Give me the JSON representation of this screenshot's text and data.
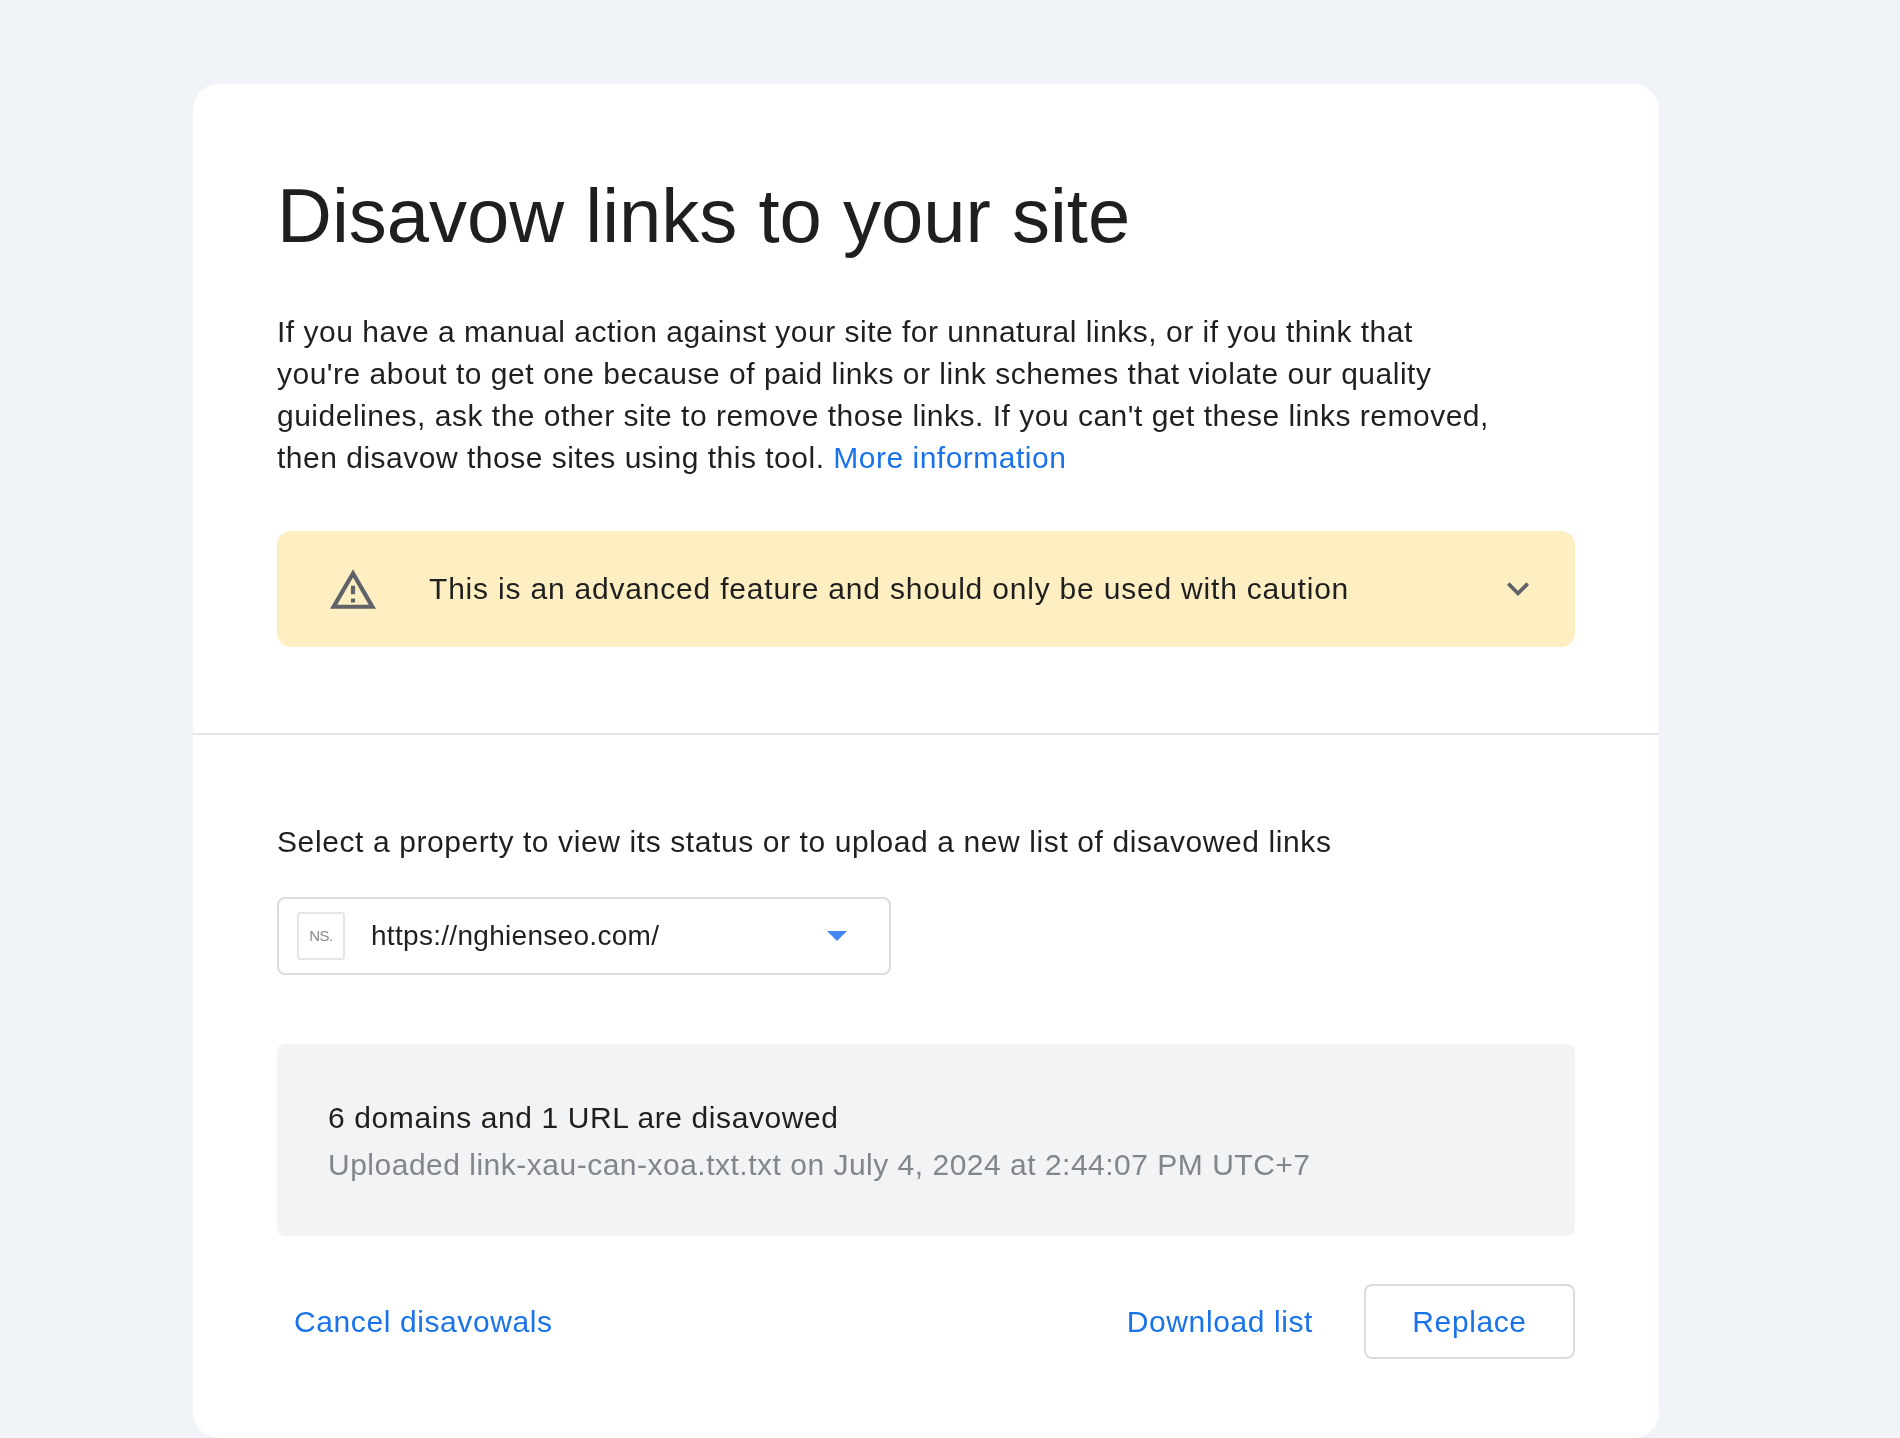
{
  "title": "Disavow links to your site",
  "intro": {
    "text": "If you have a manual action against your site for unnatural links, or if you think that you're about to get one because of paid links or link schemes that violate our quality guidelines, ask the other site to remove those links. If you can't get these links removed, then disavow those sites using this tool.",
    "link": "More information"
  },
  "warning": {
    "text": "This is an advanced feature and should only be used with caution",
    "expanded": false
  },
  "property_picker": {
    "label": "Select a property to view its status or to upload a new list of disavowed links",
    "favicon_text": "NS.",
    "value": "https://nghienseo.com/"
  },
  "status": {
    "summary": "6 domains and 1 URL are disavowed",
    "detail": "Uploaded link-xau-can-xoa.txt.txt on July 4, 2024 at 2:44:07 PM UTC+7"
  },
  "actions_start": [
    {
      "label": "Cancel disavowals",
      "kind": "text"
    }
  ],
  "actions_end": [
    {
      "label": "Download list",
      "kind": "text"
    },
    {
      "label": "Replace",
      "kind": "outlined"
    }
  ]
}
